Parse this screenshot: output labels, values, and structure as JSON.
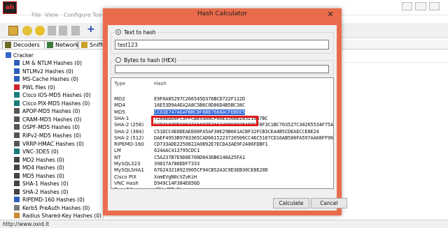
{
  "app": {
    "icon_text": "ah",
    "menu": [
      "File",
      "View",
      "Configure",
      "Too"
    ]
  },
  "tabs": [
    {
      "label": "Decoders",
      "icon": "decoder-icon"
    },
    {
      "label": "Network",
      "icon": "network-icon"
    },
    {
      "label": "Sniffe",
      "icon": "sniffer-icon"
    }
  ],
  "tree": {
    "root": "Cracker",
    "items": [
      "LM & NTLM Hashes (0)",
      "NTLMv2 Hashes (0)",
      "MS-Cache Hashes (0)",
      "PWL files (0)",
      "Cisco IOS-MD5 Hashes (0)",
      "Cisco PIX-MD5 Hashes (0)",
      "APOP-MD5 Hashes (0)",
      "CRAM-MD5 Hashes (0)",
      "OSPF-MD5 Hashes (0)",
      "RIPv2-MD5 Hashes (0)",
      "VRRP-HMAC Hashes (0)",
      "VNC-3DES (0)",
      "MD2 Hashes (0)",
      "MD4 Hashes (0)",
      "MD5 Hashes (0)",
      "SHA-1 Hashes (0)",
      "SHA-2 Hashes (0)",
      "RIPEMD-160 Hashes (0)",
      "Kerb5 PreAuth Hashes (0)",
      "Radius Shared-Key Hashes (0)"
    ]
  },
  "status": "http://www.oxid.it",
  "dialog": {
    "title": "Hash Calculator",
    "close_glyph": "✕",
    "text_radio": "Text to hash",
    "text_value": "test123",
    "bytes_radio": "Bytes to hash (HEX)",
    "bytes_value": "",
    "columns": {
      "type": "Type",
      "hash": "Hash"
    },
    "rows": [
      {
        "type": "MD2",
        "hash": "E9F6A85297C266545D376BCD722F112D"
      },
      {
        "type": "MD4",
        "hash": "16E53D9A4EA2A8C5B6C0D86D4B5BC38C"
      },
      {
        "type": "MD5",
        "hash": "CC03E747A6AFBBCBF8BE7668ACFEBEE5",
        "selected": true
      },
      {
        "type": "SHA-1",
        "hash": "7288EDD0FC3FFCBE93A0CF06E3568E28521687BC"
      },
      {
        "type": "SHA-2 (256)",
        "hash": "ECD71870D1963316A97E3AC3408C9835AD8CF0F3C1BC703527C30265534F75AE"
      },
      {
        "type": "SHA-2 (384)",
        "hash": "C51DCC4E0DEAEE00FA5AF30E29B661ACBF32FCB3CEA4B5CDEAECCE8E24"
      },
      {
        "type": "SHA-2 (512)",
        "hash": "DAEF4953B9783365CAD6615223720506CC46C5167CD16AB500FA597AA08FF964"
      },
      {
        "type": "RIPEMD-160",
        "hash": "CD733ADE2250822A0892E7ECDA3AE9F2486FDBF1"
      },
      {
        "type": "LM",
        "hash": "624AAC413795CDC1"
      },
      {
        "type": "NT",
        "hash": "C5A237B7E9D8E708D8436B6148A25FA1"
      },
      {
        "type": "MySQL323",
        "hash": "39817A786DDF7333"
      },
      {
        "type": "MySQLSHA1",
        "hash": "676243218923905CF94CB52A3C9D3EB30CE8E20D"
      },
      {
        "type": "Cisco PIX",
        "hash": "XomEVgN0cVZvKiH"
      },
      {
        "type": "VNC Hash",
        "hash": "D949C14F384E856D"
      },
      {
        "type": "Base64",
        "hash": "dGVzdDEyMw=="
      }
    ],
    "calculate_label": "Calculate",
    "cancel_label": "Cancel"
  }
}
